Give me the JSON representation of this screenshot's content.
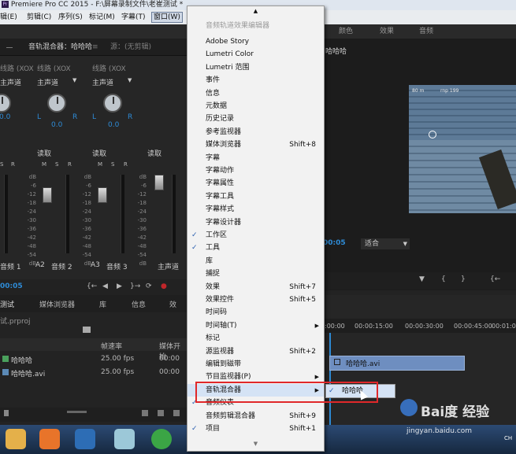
{
  "app_title": "Premiere Pro CC 2015 - F:\\屏幕录制文件\\老崔测试 *",
  "menubar": {
    "items": [
      "辑(E)",
      "剪辑(C)",
      "序列(S)",
      "标记(M)",
      "字幕(T)",
      "窗口(W)"
    ]
  },
  "right_header_tabs": [
    "颜色",
    "效果",
    "音频"
  ],
  "mixer": {
    "tabs": [
      "音轨混合器：哈哈哈",
      "源：(无剪辑)"
    ],
    "channel_labels": [
      "线路 (XOX",
      "线路 (XOX",
      "线路 (XOX"
    ],
    "track_type": "主声道",
    "pan_values": [
      "0.0",
      "0.0",
      "0.0"
    ],
    "lr": [
      "L",
      "R"
    ],
    "read_mode": "读取",
    "msr": [
      "M",
      "S",
      "R"
    ],
    "db_scale": [
      "dB",
      "-6",
      "-12",
      "-18",
      "-24",
      "-30",
      "-36",
      "-42",
      "-48",
      "-54",
      "dB"
    ],
    "track_names": [
      "音频 1",
      "A2",
      "音频 2",
      "A3",
      "音频 3",
      "主声道"
    ],
    "timecode": "00:05",
    "transport": [
      "{←",
      "◀",
      "▶",
      "}→",
      "⟳",
      "●"
    ]
  },
  "program": {
    "tab_label": "哈哈哈",
    "timecode": "00:05",
    "fit_label": "适合",
    "hud_texts": [
      "80 m",
      "rnp 199"
    ]
  },
  "project": {
    "tabs": [
      "测试",
      "媒体浏览器",
      "库",
      "信息",
      "效"
    ],
    "filename": "试.prproj",
    "columns": [
      "帧速率",
      "媒体开始"
    ],
    "rows": [
      {
        "name": "哈哈哈",
        "fps": "25.00 fps",
        "start": "00:00"
      },
      {
        "name": "哈哈哈.avi",
        "fps": "25.00 fps",
        "start": "00:00"
      }
    ]
  },
  "timeline": {
    "ruler": [
      ":00:00",
      "00:00:15:00",
      "00:00:30:00",
      "00:00:45:00",
      "00:01:0"
    ],
    "clip_label": "哈哈哈.avi"
  },
  "window_menu": {
    "header": "音频轨道效果编辑器",
    "items": [
      {
        "label": "Adobe Story"
      },
      {
        "label": "Lumetri Color"
      },
      {
        "label": "Lumetri 范围"
      },
      {
        "label": "事件"
      },
      {
        "label": "信息"
      },
      {
        "label": "元数据"
      },
      {
        "label": "历史记录"
      },
      {
        "label": "参考监视器"
      },
      {
        "label": "媒体浏览器",
        "shortcut": "Shift+8"
      },
      {
        "label": "字幕"
      },
      {
        "label": "字幕动作"
      },
      {
        "label": "字幕属性"
      },
      {
        "label": "字幕工具"
      },
      {
        "label": "字幕样式"
      },
      {
        "label": "字幕设计器"
      },
      {
        "label": "工作区",
        "checked": true
      },
      {
        "label": "工具",
        "checked": true
      },
      {
        "label": "库"
      },
      {
        "label": "捕捉"
      },
      {
        "label": "效果",
        "shortcut": "Shift+7"
      },
      {
        "label": "效果控件",
        "shortcut": "Shift+5"
      },
      {
        "label": "时间码"
      },
      {
        "label": "时间轴(T)",
        "submenu": true
      },
      {
        "label": "标记"
      },
      {
        "label": "源监视器",
        "shortcut": "Shift+2"
      },
      {
        "label": "编辑到磁带"
      },
      {
        "label": "节目监视器(P)",
        "submenu": true
      },
      {
        "label": "音轨混合器",
        "submenu": true,
        "highlighted": true
      },
      {
        "label": "音频仪表",
        "checked": true
      },
      {
        "label": "音频剪辑混合器",
        "shortcut": "Shift+9"
      },
      {
        "label": "项目",
        "checked": true,
        "shortcut": "Shift+1"
      }
    ],
    "submenu": {
      "label": "哈哈哈",
      "checked": true
    },
    "check_mark": "✓",
    "arrow_mark": "▶"
  },
  "watermark": {
    "brand": "Bai度 经验",
    "url": "jingyan.baidu.com"
  },
  "taskbar": {
    "tray": "CH"
  },
  "colors": {
    "accent": "#2e8bd6",
    "highlight_box": "#e0282a",
    "menu_bg": "#f2f2f2"
  }
}
